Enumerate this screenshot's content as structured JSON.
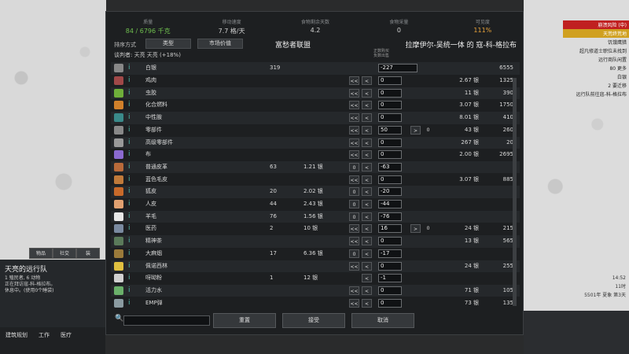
{
  "stats": [
    {
      "label": "质量",
      "value": "84 / 6796 千克",
      "cls": "g"
    },
    {
      "label": "移动速度",
      "value": "7.7 格/天",
      "cls": ""
    },
    {
      "label": "食物剩余天数",
      "value": "4.2",
      "cls": ""
    },
    {
      "label": "食物采量",
      "value": "0",
      "cls": ""
    },
    {
      "label": "可见度",
      "value": "111%",
      "cls": "o"
    }
  ],
  "header": {
    "sort_label": "排序方式",
    "sort_type": "类型",
    "sort_market": "市场价值",
    "faction": "富愁者联盟",
    "other": "拉摩伊尔-吴统一体 的 寇-科-格拉布",
    "negotiator": "谈判者: 天亮 天亮 (+18%)",
    "pos_note": "正数购买\n负数出售"
  },
  "silver": {
    "name": "白银",
    "left_count": "319",
    "field": "-227",
    "right_count": "6555"
  },
  "rows": [
    {
      "name": "鸡肉",
      "lc": "",
      "lp": "",
      "f": "0",
      "rp": "2.67 银",
      "rc": "1325",
      "col": "#a04848",
      "b1": "<<",
      "b2": "<"
    },
    {
      "name": "虫胶",
      "lc": "",
      "lp": "",
      "f": "0",
      "rp": "11 银",
      "rc": "390",
      "col": "#6fae3a",
      "b1": "<<",
      "b2": "<"
    },
    {
      "name": "化合燃料",
      "lc": "",
      "lp": "",
      "f": "0",
      "rp": "3.07 银",
      "rc": "1750",
      "col": "#d0802a",
      "b1": "<<",
      "b2": "<"
    },
    {
      "name": "中性胺",
      "lc": "",
      "lp": "",
      "f": "0",
      "rp": "8.01 银",
      "rc": "410",
      "col": "#3a8a8a",
      "b1": "<<",
      "b2": "<"
    },
    {
      "name": "零部件",
      "lc": "",
      "lp": "",
      "f": "50",
      "rp": "43 银",
      "rc": "260",
      "col": "#888",
      "b1": "<<",
      "b2": "<",
      "r1": ">",
      "r2": "0"
    },
    {
      "name": "高级零部件",
      "lc": "",
      "lp": "",
      "f": "0",
      "rp": "267 银",
      "rc": "20",
      "col": "#999",
      "b1": "<<",
      "b2": "<"
    },
    {
      "name": "布",
      "lc": "",
      "lp": "",
      "f": "0",
      "rp": "2.00 银",
      "rc": "2695",
      "col": "#8a6ad0",
      "b1": "<<",
      "b2": "<"
    },
    {
      "name": "普通皮革",
      "lc": "63",
      "lp": "1.21 银",
      "f": "-63",
      "rp": "",
      "rc": "",
      "col": "#b86a3a",
      "b1": "0",
      "b2": "<"
    },
    {
      "name": "蓝色毛皮",
      "lc": "",
      "lp": "",
      "f": "0",
      "rp": "3.07 银",
      "rc": "885",
      "col": "#c07a3a",
      "b1": "<<",
      "b2": "<"
    },
    {
      "name": "狐皮",
      "lc": "20",
      "lp": "2.02 银",
      "f": "-20",
      "rp": "",
      "rc": "",
      "col": "#c86a2a",
      "b1": "0",
      "b2": "<"
    },
    {
      "name": "人皮",
      "lc": "44",
      "lp": "2.43 银",
      "f": "-44",
      "rp": "",
      "rc": "",
      "col": "#e0a070",
      "b1": "0",
      "b2": "<"
    },
    {
      "name": "羊毛",
      "lc": "76",
      "lp": "1.56 银",
      "f": "-76",
      "rp": "",
      "rc": "",
      "col": "#e8e8e8",
      "b1": "0",
      "b2": "<"
    },
    {
      "name": "医药",
      "lc": "2",
      "lp": "10 银",
      "f": "16",
      "rp": "24 银",
      "rc": "215",
      "col": "#7a8aa0",
      "b1": "<<",
      "b2": "<",
      "r1": ">",
      "r2": "0"
    },
    {
      "name": "精神茶",
      "lc": "",
      "lp": "",
      "f": "0",
      "rp": "13 银",
      "rc": "565",
      "col": "#5a7a5a",
      "b1": "<<",
      "b2": "<"
    },
    {
      "name": "大麻烟",
      "lc": "17",
      "lp": "6.36 银",
      "f": "-17",
      "rp": "",
      "rc": "",
      "col": "#9a7a3a",
      "b1": "0",
      "b2": "<"
    },
    {
      "name": "佩诺西林",
      "lc": "",
      "lp": "",
      "f": "0",
      "rp": "24 银",
      "rc": "255",
      "col": "#e0c040",
      "b1": "<<",
      "b2": "<"
    },
    {
      "name": "呀呦粉",
      "lc": "1",
      "lp": "12 银",
      "f": "-1",
      "rp": "",
      "rc": "",
      "col": "#d0d0d0",
      "b1": "",
      "b2": "<"
    },
    {
      "name": "活力水",
      "lc": "",
      "lp": "",
      "f": "0",
      "rp": "71 银",
      "rc": "105",
      "col": "#6ab06a",
      "b1": "<<",
      "b2": "<"
    },
    {
      "name": "EMP弹",
      "lc": "",
      "lp": "",
      "f": "0",
      "rp": "73 银",
      "rc": "135",
      "col": "#8a9aa0",
      "b1": "<<",
      "b2": "<"
    }
  ],
  "buttons": {
    "reset": "重置",
    "accept": "接受",
    "cancel": "取消"
  },
  "caravan": {
    "tabs": [
      "物品",
      "社交",
      "装"
    ],
    "title": "天亮的远行队",
    "desc": "1 殖民者, 6 动物\n正在拜访寇-科-格拉布。\n休息中。(使用0个睡袋)"
  },
  "mainbar": [
    "建筑规划",
    "工作",
    "医疗"
  ],
  "alerts": [
    "崩溃风险 (中)",
    "天荒终荒地",
    "饥饿鹰猎",
    "超凡修道士职位未找到",
    "远行商队闲置",
    "80 更多",
    "白银",
    "2 要迁移",
    "",
    "",
    "",
    "",
    "",
    "",
    "远行队前往寇-科-格拉布"
  ],
  "clock": {
    "time": "14:52",
    "hours": "11时",
    "date": "5501年 夏象 第3天"
  }
}
